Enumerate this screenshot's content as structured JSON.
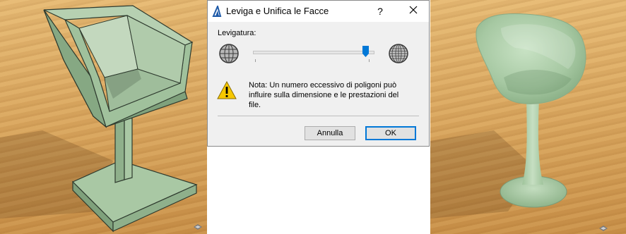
{
  "dialog": {
    "title": "Leviga e Unifica le Facce",
    "help_label": "?",
    "section_label": "Levigatura:",
    "slider": {
      "value": 0.95
    },
    "note": "Nota: Un numero eccessivo di poligoni può influire sulla dimensione e le prestazioni del file.",
    "buttons": {
      "cancel": "Annulla",
      "ok": "OK"
    }
  },
  "colors": {
    "accent": "#0078d7",
    "slider_thumb": "#0078d7",
    "warning": "#f7c800",
    "model_green": "#9cbf9a"
  },
  "icons": [
    "app-icon",
    "close-icon",
    "globe-icon",
    "warning-icon",
    "navigator-icon"
  ]
}
